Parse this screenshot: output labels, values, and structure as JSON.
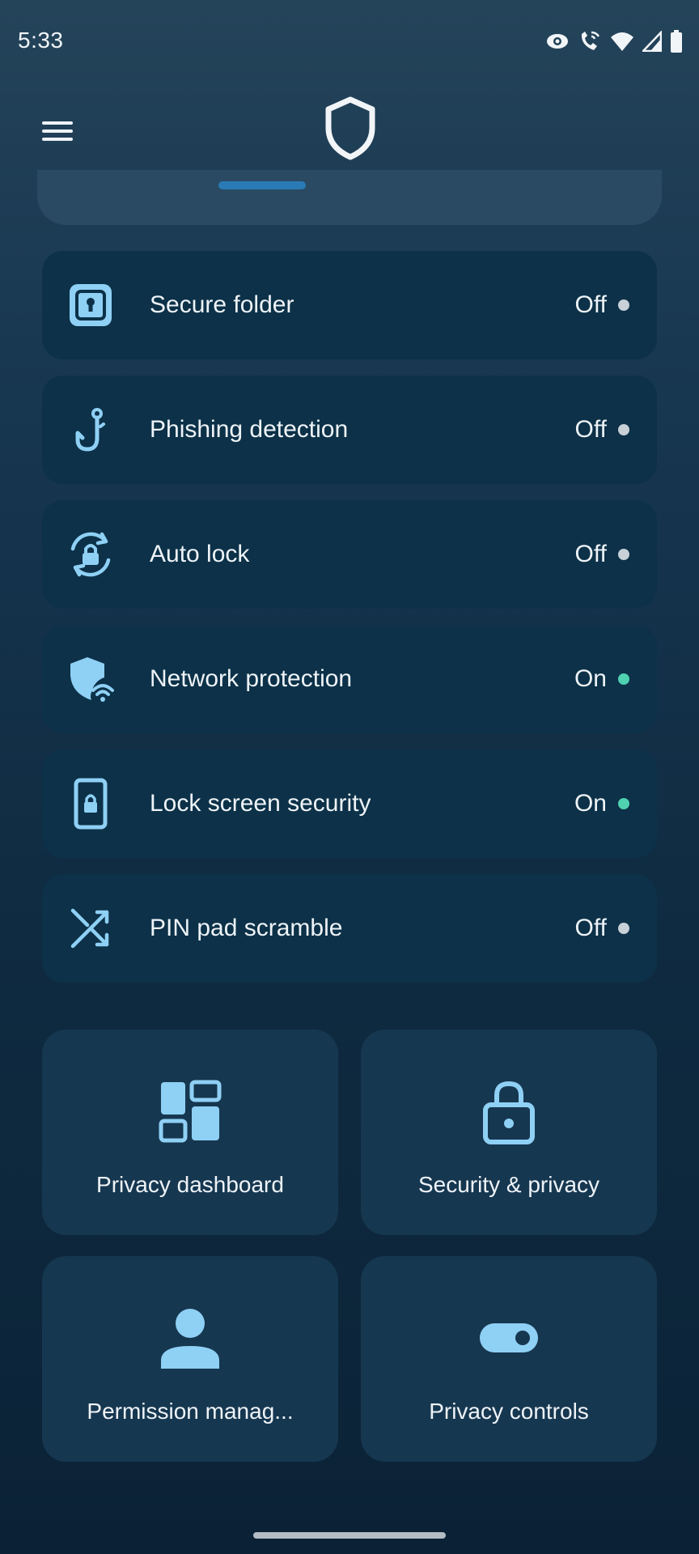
{
  "status_bar": {
    "time": "5:33",
    "icons": [
      "eye-icon",
      "wifi-calling-icon",
      "wifi-icon",
      "signal-icon",
      "battery-icon"
    ]
  },
  "header": {
    "menu_icon": "hamburger-menu-icon",
    "logo_icon": "shield-icon"
  },
  "features": [
    {
      "label": "Secure folder",
      "status": "Off",
      "icon": "secure-folder-icon",
      "on": false
    },
    {
      "label": "Phishing detection",
      "status": "Off",
      "icon": "fishhook-icon",
      "on": false
    },
    {
      "label": "Auto lock",
      "status": "Off",
      "icon": "auto-lock-icon",
      "on": false
    },
    {
      "label": "Network protection",
      "status": "On",
      "icon": "shield-wifi-icon",
      "on": true
    },
    {
      "label": "Lock screen security",
      "status": "On",
      "icon": "phone-lock-icon",
      "on": true
    },
    {
      "label": "PIN pad scramble",
      "status": "Off",
      "icon": "shuffle-icon",
      "on": false
    }
  ],
  "tiles": [
    {
      "label": "Privacy dashboard",
      "icon": "dashboard-icon"
    },
    {
      "label": "Security & privacy",
      "icon": "padlock-icon"
    },
    {
      "label": "Permission manag...",
      "icon": "person-icon"
    },
    {
      "label": "Privacy controls",
      "icon": "toggle-icon"
    }
  ],
  "colors": {
    "accent_icon": "#8fd0f5",
    "on_dot": "#4fd1b2",
    "off_dot": "#c8d0d8",
    "row_bg": "#0c3148",
    "tile_bg": "#163750"
  }
}
